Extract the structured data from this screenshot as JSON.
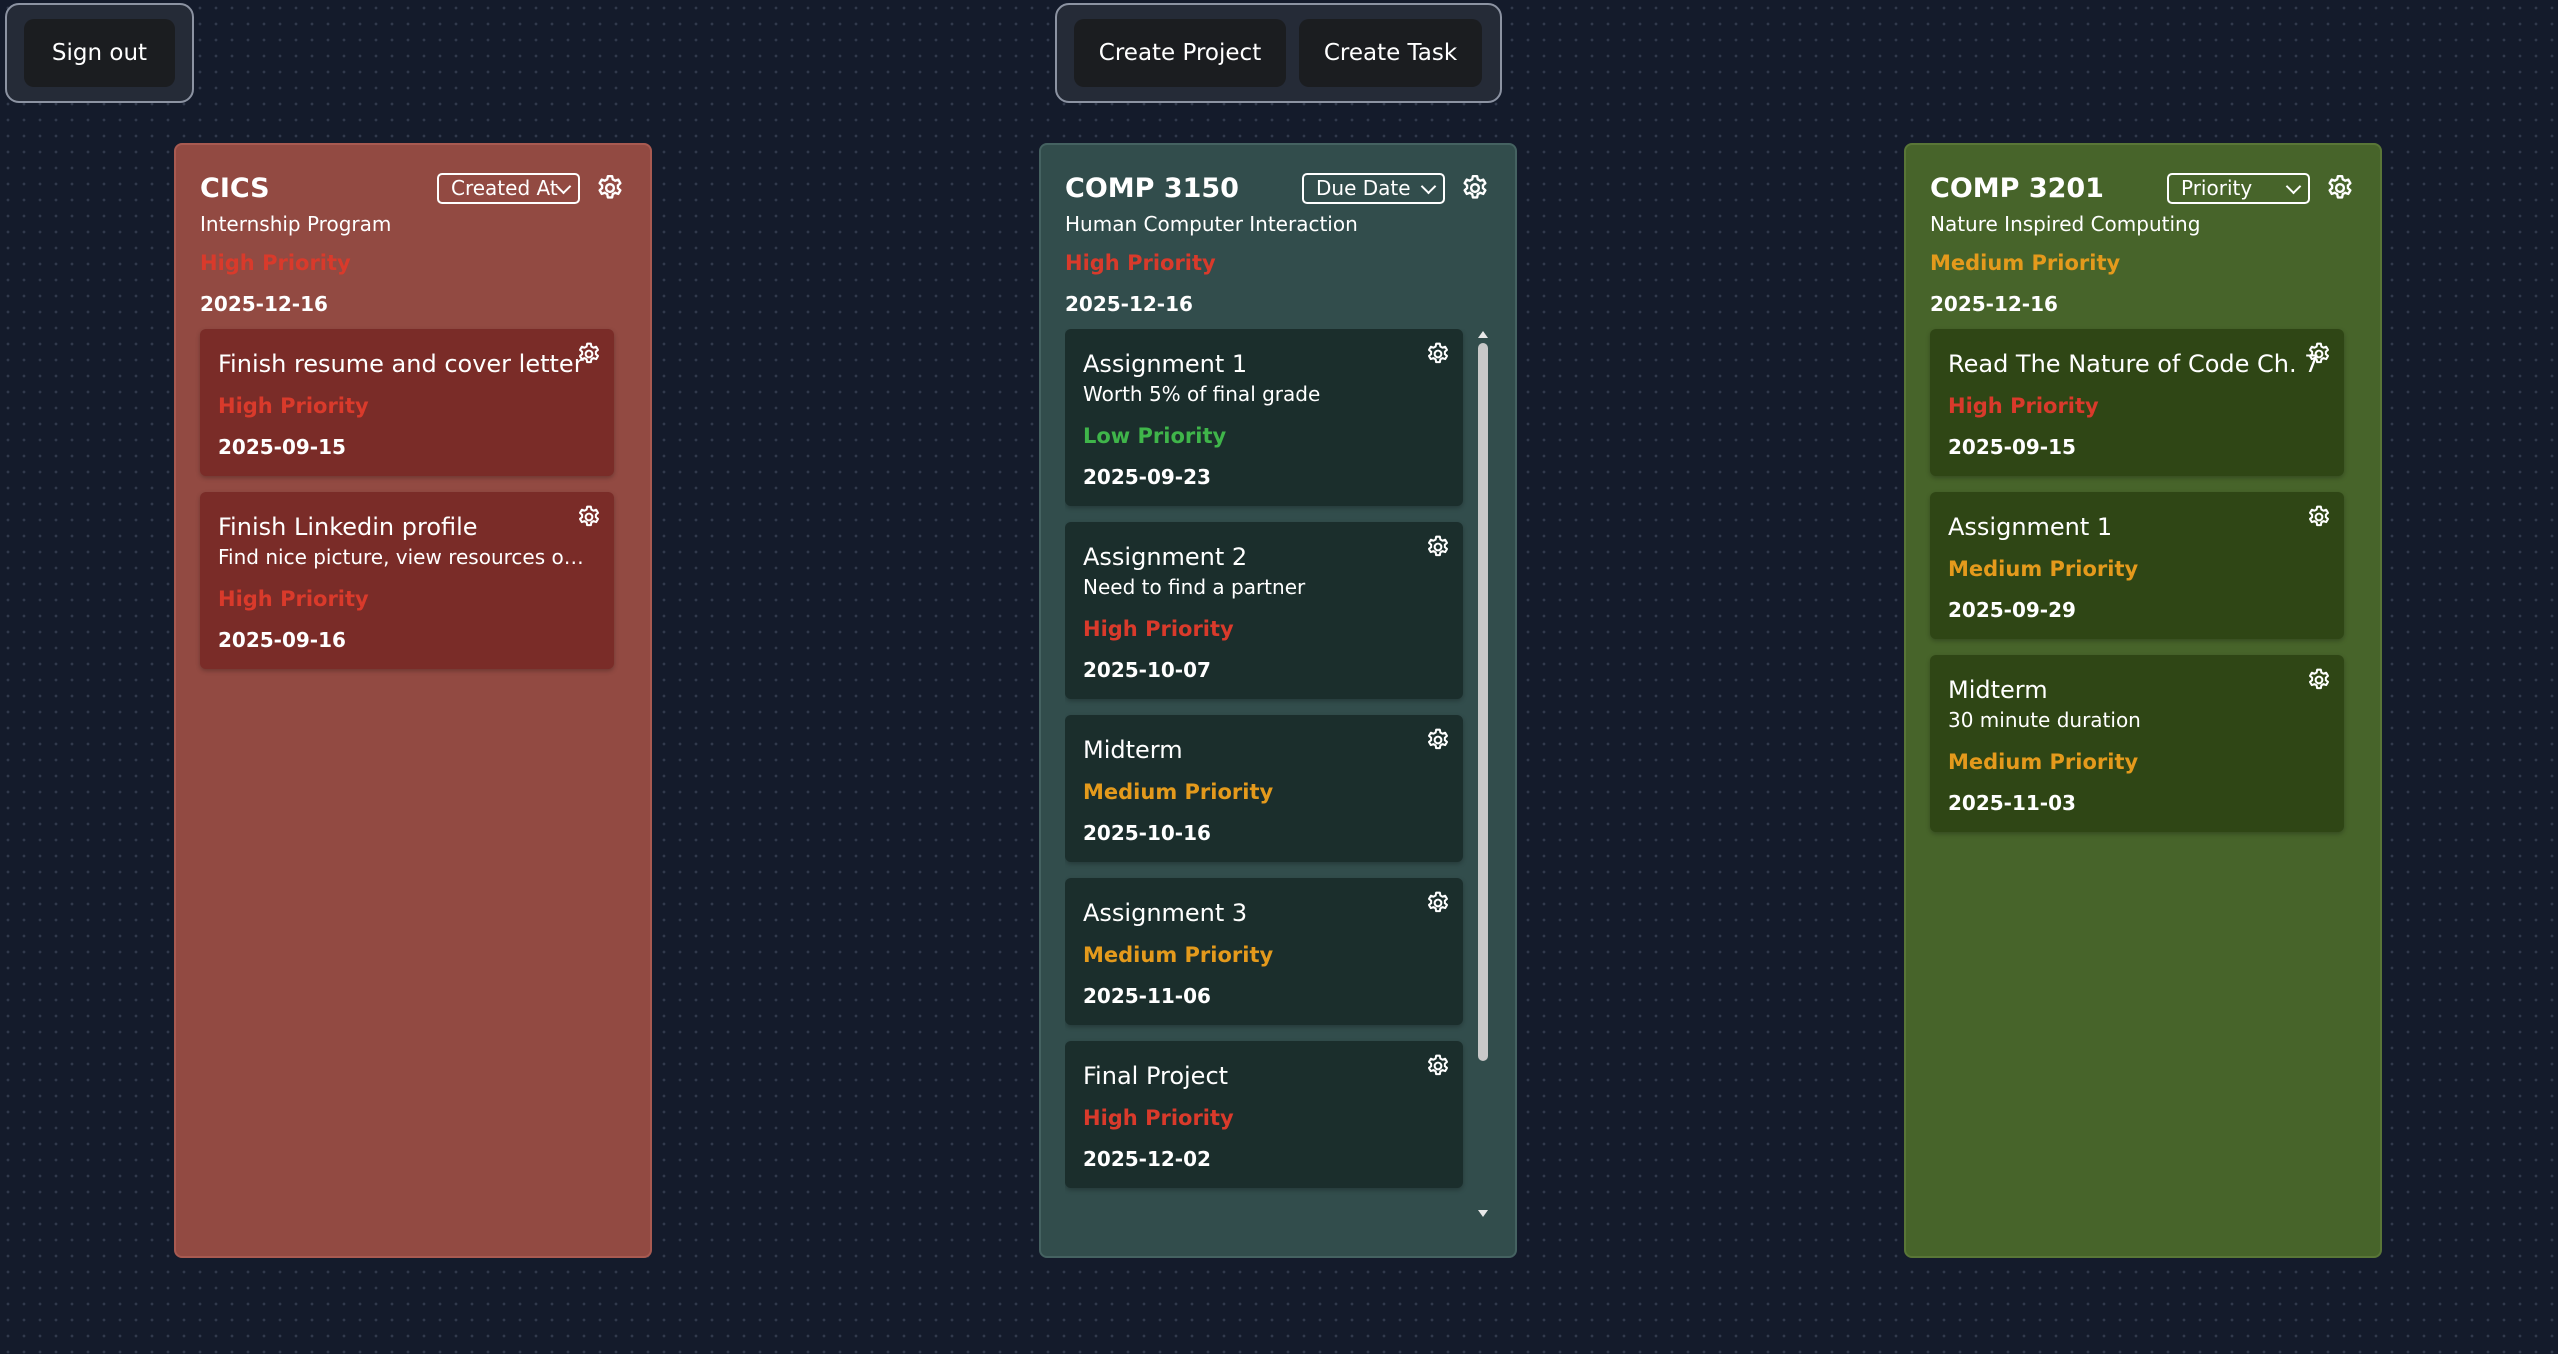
{
  "toolbar": {
    "sign_out": "Sign out",
    "create_project": "Create Project",
    "create_task": "Create Task"
  },
  "colors": {
    "high": "#d93a2b",
    "medium": "#e49a1c",
    "low": "#3fb54a",
    "col_cics": "#924a42",
    "col_comp3150": "#324d4c",
    "col_comp3201": "#47642a"
  },
  "icons": {
    "settings": "gear-icon",
    "dropdown": "chevron-down-icon"
  },
  "columns": [
    {
      "title": "CICS",
      "sort": "Created At",
      "description": "Internship Program",
      "priority": "High Priority",
      "priority_level": "high",
      "date": "2025-12-16",
      "tasks": [
        {
          "title": "Finish resume and cover letter",
          "description": "",
          "priority": "High Priority",
          "priority_level": "high",
          "date": "2025-09-15"
        },
        {
          "title": "Finish Linkedin profile",
          "description": "Find nice picture, view resources on Bri...",
          "priority": "High Priority",
          "priority_level": "high",
          "date": "2025-09-16"
        }
      ]
    },
    {
      "title": "COMP 3150",
      "sort": "Due Date",
      "description": "Human Computer Interaction",
      "priority": "High Priority",
      "priority_level": "high",
      "date": "2025-12-16",
      "tasks": [
        {
          "title": "Assignment 1",
          "description": "Worth 5% of final grade",
          "priority": "Low Priority",
          "priority_level": "low",
          "date": "2025-09-23"
        },
        {
          "title": "Assignment 2",
          "description": "Need to find a partner",
          "priority": "High Priority",
          "priority_level": "high",
          "date": "2025-10-07"
        },
        {
          "title": "Midterm",
          "description": "",
          "priority": "Medium Priority",
          "priority_level": "medium",
          "date": "2025-10-16"
        },
        {
          "title": "Assignment 3",
          "description": "",
          "priority": "Medium Priority",
          "priority_level": "medium",
          "date": "2025-11-06"
        },
        {
          "title": "Final Project",
          "description": "",
          "priority": "High Priority",
          "priority_level": "high",
          "date": "2025-12-02"
        }
      ]
    },
    {
      "title": "COMP 3201",
      "sort": "Priority",
      "description": "Nature Inspired Computing",
      "priority": "Medium Priority",
      "priority_level": "medium",
      "date": "2025-12-16",
      "tasks": [
        {
          "title": "Read The Nature of Code Ch. 7",
          "description": "",
          "priority": "High Priority",
          "priority_level": "high",
          "date": "2025-09-15"
        },
        {
          "title": "Assignment 1",
          "description": "",
          "priority": "Medium Priority",
          "priority_level": "medium",
          "date": "2025-09-29"
        },
        {
          "title": "Midterm",
          "description": "30 minute duration",
          "priority": "Medium Priority",
          "priority_level": "medium",
          "date": "2025-11-03"
        }
      ]
    }
  ]
}
